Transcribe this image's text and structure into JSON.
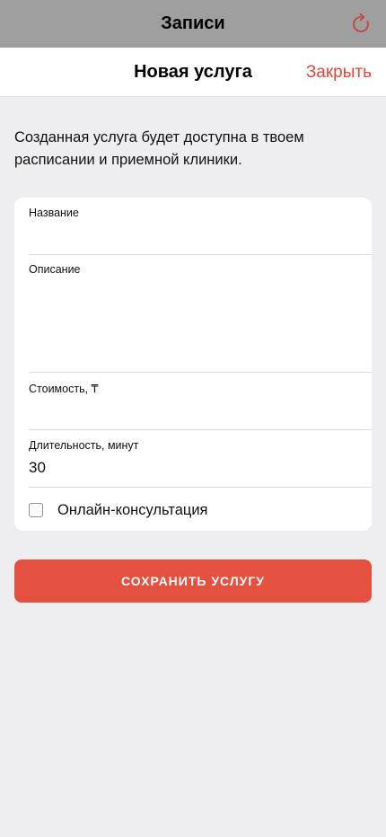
{
  "top_bar": {
    "title": "Записи",
    "refresh_icon": "refresh-icon"
  },
  "header": {
    "title": "Новая услуга",
    "close_label": "Закрыть"
  },
  "intro_text": "Созданная услуга будет доступна в твоем расписании и приемной клиники.",
  "form": {
    "name_label": "Название",
    "name_value": "",
    "description_label": "Описание",
    "description_value": "",
    "price_label": "Стоимость, ₸",
    "price_value": "",
    "duration_label": "Длительность, минут",
    "duration_value": "30",
    "online_label": "Онлайн-консультация",
    "online_checked": false
  },
  "save_button_label": "СОХРАНИТЬ УСЛУГУ",
  "colors": {
    "accent": "#e45141",
    "close_link": "#d84a3d",
    "top_bar": "#9f9f9f",
    "background": "#eeeef0"
  }
}
